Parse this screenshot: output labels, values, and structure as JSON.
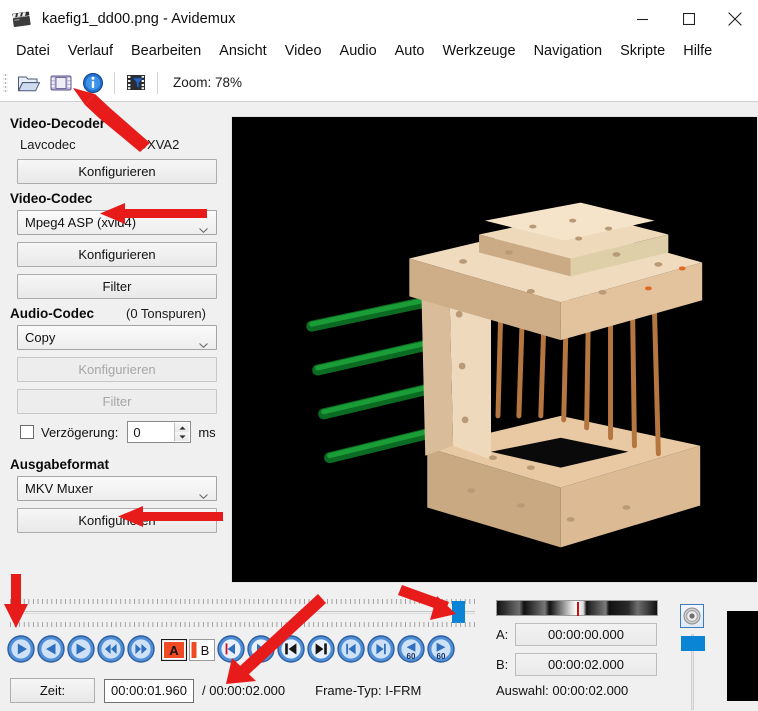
{
  "window": {
    "title": "kaefig1_dd00.png - Avidemux",
    "icon": "clapperboard-icon",
    "controls": [
      {
        "name": "minimize",
        "glyph": "minimize-icon"
      },
      {
        "name": "maximize",
        "glyph": "maximize-icon"
      },
      {
        "name": "close",
        "glyph": "close-icon"
      }
    ]
  },
  "menu": {
    "items": [
      {
        "label": "Datei"
      },
      {
        "label": "Verlauf"
      },
      {
        "label": "Bearbeiten"
      },
      {
        "label": "Ansicht"
      },
      {
        "label": "Video"
      },
      {
        "label": "Audio"
      },
      {
        "label": "Auto"
      },
      {
        "label": "Werkzeuge"
      },
      {
        "label": "Navigation"
      },
      {
        "label": "Skripte"
      },
      {
        "label": "Hilfe"
      }
    ]
  },
  "toolbar": {
    "buttons": [
      {
        "name": "open-file-icon"
      },
      {
        "name": "save-file-icon"
      },
      {
        "name": "info-icon"
      },
      {
        "name": "filters-icon"
      }
    ],
    "zoom_label": "Zoom: 78%"
  },
  "sidebar": {
    "video_decoder": {
      "heading": "Video-Decoder",
      "name_value": "Lavcodec",
      "mode_value": "DXVA2",
      "configure_label": "Konfigurieren"
    },
    "video_codec": {
      "heading": "Video-Codec",
      "selected": "Mpeg4 ASP (xvid4)",
      "configure_label": "Konfigurieren",
      "filter_label": "Filter"
    },
    "audio_codec": {
      "heading": "Audio-Codec",
      "tracks_note": "(0 Tonspuren)",
      "selected": "Copy",
      "configure_label": "Konfigurieren",
      "filter_label": "Filter",
      "delay_label": "Verzögerung:",
      "delay_value": "0",
      "delay_unit": "ms"
    },
    "output_format": {
      "heading": "Ausgabeformat",
      "selected": "MKV Muxer",
      "configure_label": "Konfigurieren"
    }
  },
  "transport": {
    "buttons": [
      {
        "name": "play-button"
      },
      {
        "name": "previous-frame-button"
      },
      {
        "name": "next-frame-button"
      },
      {
        "name": "rewind-button"
      },
      {
        "name": "forward-button"
      },
      {
        "name": "mark-a-button",
        "label": "A"
      },
      {
        "name": "mark-b-button",
        "label": "B"
      },
      {
        "name": "goto-marker-a-button"
      },
      {
        "name": "goto-marker-b-button"
      },
      {
        "name": "previous-keyframe-button"
      },
      {
        "name": "next-keyframe-button"
      },
      {
        "name": "previous-black-frame-button"
      },
      {
        "name": "next-black-frame-button"
      },
      {
        "name": "back-60s-button",
        "label": "60"
      },
      {
        "name": "forward-60s-button",
        "label": "60"
      }
    ]
  },
  "timebar": {
    "zeit_label": "Zeit:",
    "current_time": "00:00:01.960",
    "total_time": "/ 00:00:02.000",
    "frame_type": "Frame-Typ: I-FRM",
    "slider_position_percent": 97
  },
  "selection": {
    "a_label": "A:",
    "a_value": "00:00:00.000",
    "b_label": "B:",
    "b_value": "00:00:02.000",
    "summary": "Auswahl: 00:00:02.000"
  },
  "volume": {
    "icon": "speaker-icon"
  },
  "colors": {
    "accent_blue": "#0a85d6",
    "annotation_red": "#e81b1b",
    "window_bg": "#f0f0f0",
    "panel_white": "#ffffff",
    "marker_a_red": "#ef4a22"
  },
  "annotations": [
    {
      "name": "arrow-to-save-icon",
      "target": "save-file-icon"
    },
    {
      "name": "arrow-to-video-codec",
      "target": "Video-Codec"
    },
    {
      "name": "arrow-to-ausgabeformat",
      "target": "Ausgabeformat"
    },
    {
      "name": "arrow-to-play-button",
      "target": "play-button"
    },
    {
      "name": "arrow-to-time-field",
      "target": "current_time"
    },
    {
      "name": "arrow-to-slider-handle",
      "target": "slider-handle"
    }
  ]
}
